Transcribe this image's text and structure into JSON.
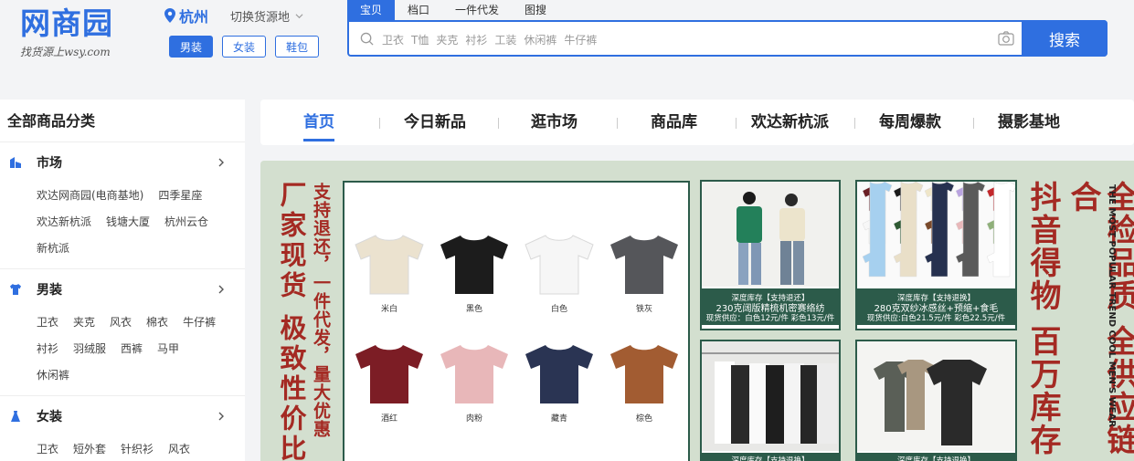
{
  "header": {
    "logo": "网商园",
    "slogan": "找货源上wsy.com",
    "city": "杭州",
    "switch_label": "切换货源地",
    "categories": [
      "男装",
      "女装",
      "鞋包"
    ],
    "search_tabs": [
      "宝贝",
      "档口",
      "一件代发",
      "图搜"
    ],
    "search_hints": [
      "卫衣",
      "T恤",
      "夹克",
      "衬衫",
      "工装",
      "休闲裤",
      "牛仔裤"
    ],
    "search_button": "搜索"
  },
  "sidebar": {
    "title": "全部商品分类",
    "sections": [
      {
        "title": "市场",
        "icon": "building-icon",
        "links": [
          "欢达网商园(电商基地)",
          "四季星座",
          "欢达新杭派",
          "钱塘大厦",
          "杭州云仓",
          "新杭派"
        ]
      },
      {
        "title": "男装",
        "icon": "shirt-icon",
        "links": [
          "卫衣",
          "夹克",
          "风衣",
          "棉衣",
          "牛仔裤",
          "衬衫",
          "羽绒服",
          "西裤",
          "马甲",
          "休闲裤"
        ]
      },
      {
        "title": "女装",
        "icon": "dress-icon",
        "links": [
          "卫衣",
          "短外套",
          "针织衫",
          "风衣"
        ]
      }
    ]
  },
  "nav": {
    "items": [
      "首页",
      "今日新品",
      "逛市场",
      "商品库",
      "欢达新杭派",
      "每周爆款",
      "摄影基地"
    ]
  },
  "banner": {
    "left_big": "厂家现货 极致性价比",
    "left_small": "支持退还，一件代发，量大优惠",
    "tees": [
      {
        "label": "米白",
        "color": "#ebe2cf"
      },
      {
        "label": "黑色",
        "color": "#1c1c1c"
      },
      {
        "label": "白色",
        "color": "#f6f6f6"
      },
      {
        "label": "铁灰",
        "color": "#55565a"
      },
      {
        "label": "酒红",
        "color": "#7c1d25"
      },
      {
        "label": "肉粉",
        "color": "#e8b7b9"
      },
      {
        "label": "藏青",
        "color": "#2a3453"
      },
      {
        "label": "棕色",
        "color": "#a25c32"
      }
    ],
    "card1_caption": [
      "深度库存【支持退还】",
      "230克阔版精梳机密赛络纺",
      "现货供应：白色12元/件 彩色13元/件"
    ],
    "card2_caption": [
      "深度库存【支持退换】",
      "280克双纱冰感丝+预缩+食毛",
      "现货供应:白色21.5元/件 彩色22.5元/件"
    ],
    "card3_caption": "深度库存【支持退换】",
    "card4_caption": "深度库存【支持退换】",
    "right_col1": "抖音得物 百万库存",
    "right_col2": "全检品质 全供应链合",
    "english": "THE MOST POPULAR TREND COOL MEN'S WEAR",
    "colors": {
      "green": "#2c5b4a",
      "red": "#a42a23",
      "bg": "#d3dfcf"
    }
  },
  "colors": {
    "brand": "#2f6fe0"
  }
}
